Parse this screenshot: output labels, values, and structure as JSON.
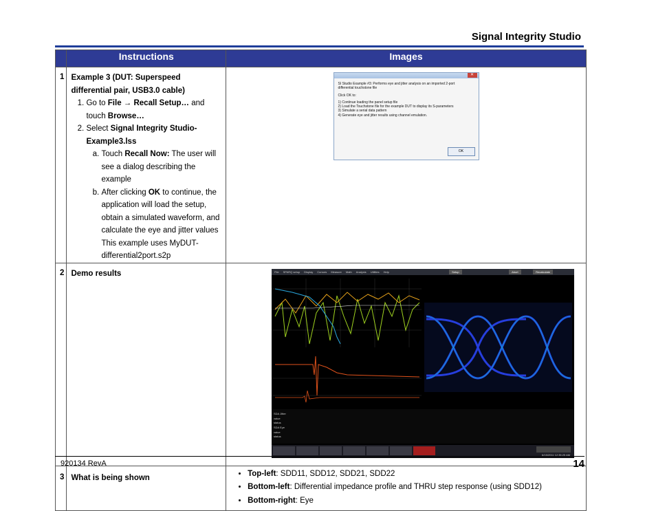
{
  "header": {
    "title": "Signal Integrity Studio"
  },
  "table": {
    "col_instructions": "Instructions",
    "col_images": "Images",
    "rows": [
      {
        "num": "1",
        "title": "Example 3 (DUT: Superspeed differential pair, USB3.0 cable)",
        "step1": {
          "pre": "Go to ",
          "file": "File",
          "arrow": " → ",
          "recall": "Recall Setup…",
          "mid": " and touch ",
          "browse": "Browse…"
        },
        "step2": {
          "pre": "Select ",
          "bold": "Signal Integrity Studio-Example3.lss"
        },
        "sub_a": {
          "pre": "Touch ",
          "bold": "Recall Now:",
          "post": " The user will see a dialog describing the example"
        },
        "sub_b": {
          "pre": "After clicking ",
          "bold": "OK",
          "post": " to continue, the application will load the setup, obtain a simulated waveform, and calculate the eye and jitter values"
        },
        "note": "This example uses MyDUT-differential2port.s2p"
      },
      {
        "num": "2",
        "title": "Demo results"
      },
      {
        "num": "3",
        "title": "What is being shown",
        "bullets": [
          {
            "bold": "Top-left",
            "text": ": SDD11, SDD12, SDD21, SDD22"
          },
          {
            "bold": "Bottom-left",
            "text": ": Differential impedance profile and THRU step response (using SDD12)"
          },
          {
            "bold": "Bottom-right",
            "text": ": Eye"
          }
        ]
      }
    ]
  },
  "dialog": {
    "lines": [
      "SI Studio Example #3: Performs eye and jitter analysis on an imported 2-port",
      "differential touchstone file",
      "",
      "Click OK to:",
      "",
      "1) Continue loading the panel setup file",
      "2) Load the Touchstone file for the example DUT to display its S-parameters",
      "3) Simulate a serial data pattern",
      "4) Generate eye and jitter results using channel emulation."
    ],
    "ok": "OK"
  },
  "scope": {
    "menu": [
      "File",
      "SPARQ setup",
      "Display",
      "Cursors",
      "Measure",
      "Math",
      "Analysis",
      "Utilities",
      "Help"
    ],
    "buttons": [
      "Setup",
      "Abort",
      "Recalculate"
    ],
    "timestamp": "6/15/2011 12:35:25 AM"
  },
  "footer": {
    "doc": "920134 RevA",
    "page": "14"
  }
}
